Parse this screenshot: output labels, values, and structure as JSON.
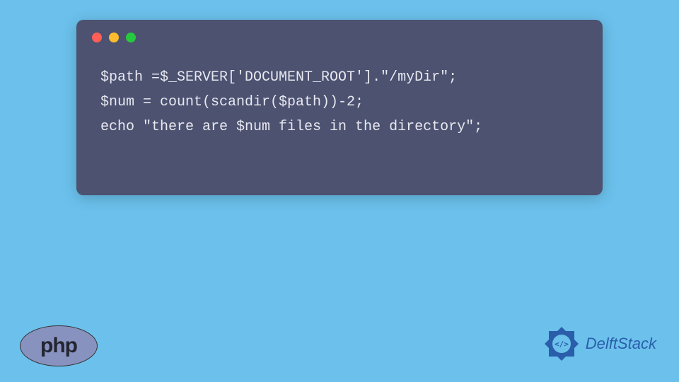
{
  "code": {
    "line1": "$path =$_SERVER['DOCUMENT_ROOT'].\"/myDir\";",
    "line2": "$num = count(scandir($path))-2;",
    "line3": "echo \"there are $num files in the directory\";"
  },
  "logos": {
    "php": "php",
    "delftstack": "DelftStack"
  }
}
